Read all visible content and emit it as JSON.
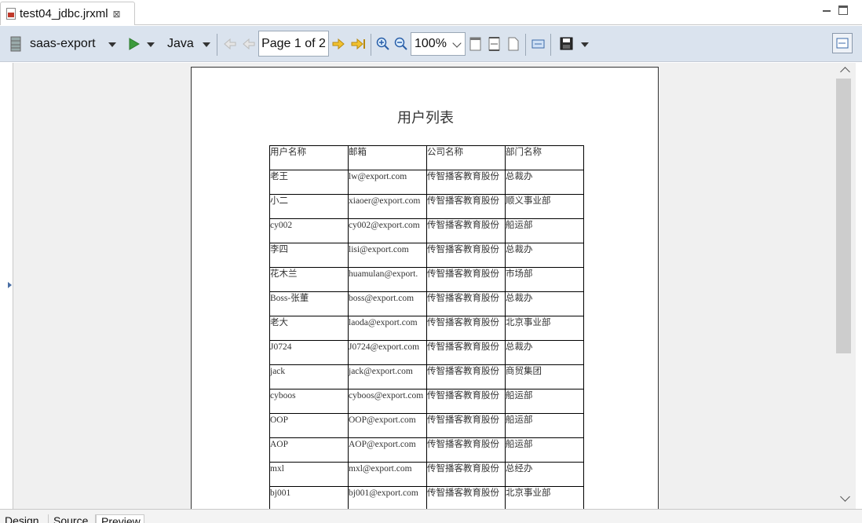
{
  "editor_tab": {
    "title": "test04_jdbc.jrxml",
    "close": "⊠"
  },
  "toolbar": {
    "datasource": "saas-export",
    "language": "Java",
    "page_indicator": "Page 1 of 2",
    "zoom": "100%"
  },
  "report": {
    "title": "用户列表",
    "headers": [
      "用户名称",
      "邮箱",
      "公司名称",
      "部门名称"
    ],
    "rows": [
      [
        "老王",
        "lw@export.com",
        "传智播客教育股份",
        "总裁办"
      ],
      [
        "小二",
        "xiaoer@export.com",
        "传智播客教育股份",
        "顺义事业部"
      ],
      [
        "cy002",
        "cy002@export.com",
        "传智播客教育股份",
        "船运部"
      ],
      [
        "李四",
        "lisi@export.com",
        "传智播客教育股份",
        "总裁办"
      ],
      [
        "花木兰",
        "huamulan@export.",
        "传智播客教育股份",
        "市场部"
      ],
      [
        "Boss-张董",
        "boss@export.com",
        "传智播客教育股份",
        "总裁办"
      ],
      [
        "老大",
        "laoda@export.com",
        "传智播客教育股份",
        "北京事业部"
      ],
      [
        "J0724",
        "J0724@export.com",
        "传智播客教育股份",
        "总裁办"
      ],
      [
        "jack",
        "jack@export.com",
        "传智播客教育股份",
        "商贸集团"
      ],
      [
        "cyboos",
        "cyboos@export.com",
        "传智播客教育股份",
        "船运部"
      ],
      [
        "OOP",
        "OOP@export.com",
        "传智播客教育股份",
        "船运部"
      ],
      [
        "AOP",
        "AOP@export.com",
        "传智播客教育股份",
        "船运部"
      ],
      [
        "mxl",
        "mxl@export.com",
        "传智播客教育股份",
        "总经办"
      ],
      [
        "bj001",
        "bj001@export.com",
        "传智播客教育股份",
        "北京事业部"
      ]
    ]
  },
  "bottom_tabs": [
    "Design",
    "Source",
    "Preview"
  ]
}
